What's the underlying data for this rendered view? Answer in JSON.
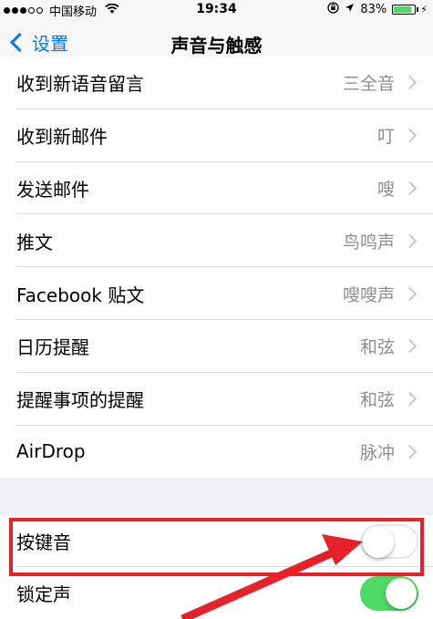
{
  "status_bar": {
    "carrier": "中国移动",
    "time": "19:34",
    "battery_percent": "83%",
    "battery_level": 0.83
  },
  "nav": {
    "back_label": "设置",
    "title": "声音与触感"
  },
  "sound_rows": [
    {
      "label": "收到新语音留言",
      "value": "三全音"
    },
    {
      "label": "收到新邮件",
      "value": "叮"
    },
    {
      "label": "发送邮件",
      "value": "嗖"
    },
    {
      "label": "推文",
      "value": "鸟鸣声"
    },
    {
      "label": "Facebook 贴文",
      "value": "嗖嗖声"
    },
    {
      "label": "日历提醒",
      "value": "和弦"
    },
    {
      "label": "提醒事项的提醒",
      "value": "和弦"
    },
    {
      "label": "AirDrop",
      "value": "脉冲"
    }
  ],
  "toggle_rows": [
    {
      "label": "按键音",
      "on": false
    },
    {
      "label": "锁定声",
      "on": true
    }
  ],
  "colors": {
    "accent": "#007aff",
    "toggle_on": "#4cd964",
    "annotation": "#e8202a"
  }
}
